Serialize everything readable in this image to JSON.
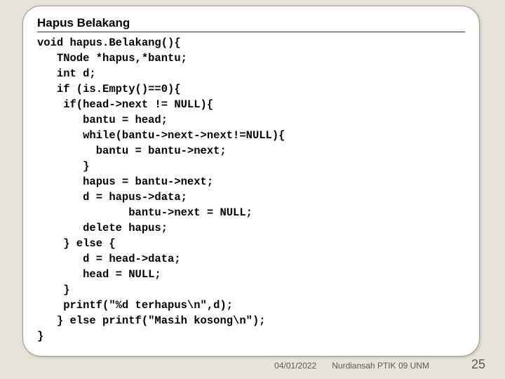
{
  "slide": {
    "title": "Hapus Belakang",
    "code_lines": [
      "void hapus.Belakang(){",
      "   TNode *hapus,*bantu;",
      "   int d;",
      "   if (is.Empty()==0){",
      "    if(head->next != NULL){",
      "       bantu = head;",
      "       while(bantu->next->next!=NULL){",
      "         bantu = bantu->next;",
      "       }",
      "       hapus = bantu->next;",
      "       d = hapus->data;",
      "              bantu->next = NULL;",
      "       delete hapus;",
      "    } else {",
      "       d = head->data;",
      "       head = NULL;",
      "    }",
      "    printf(\"%d terhapus\\n\",d);",
      "   } else printf(\"Masih kosong\\n\");",
      "}"
    ],
    "footer_date": "04/01/2022",
    "footer_note": "Nurdiansah PTIK 09 UNM",
    "page_number": "25"
  }
}
